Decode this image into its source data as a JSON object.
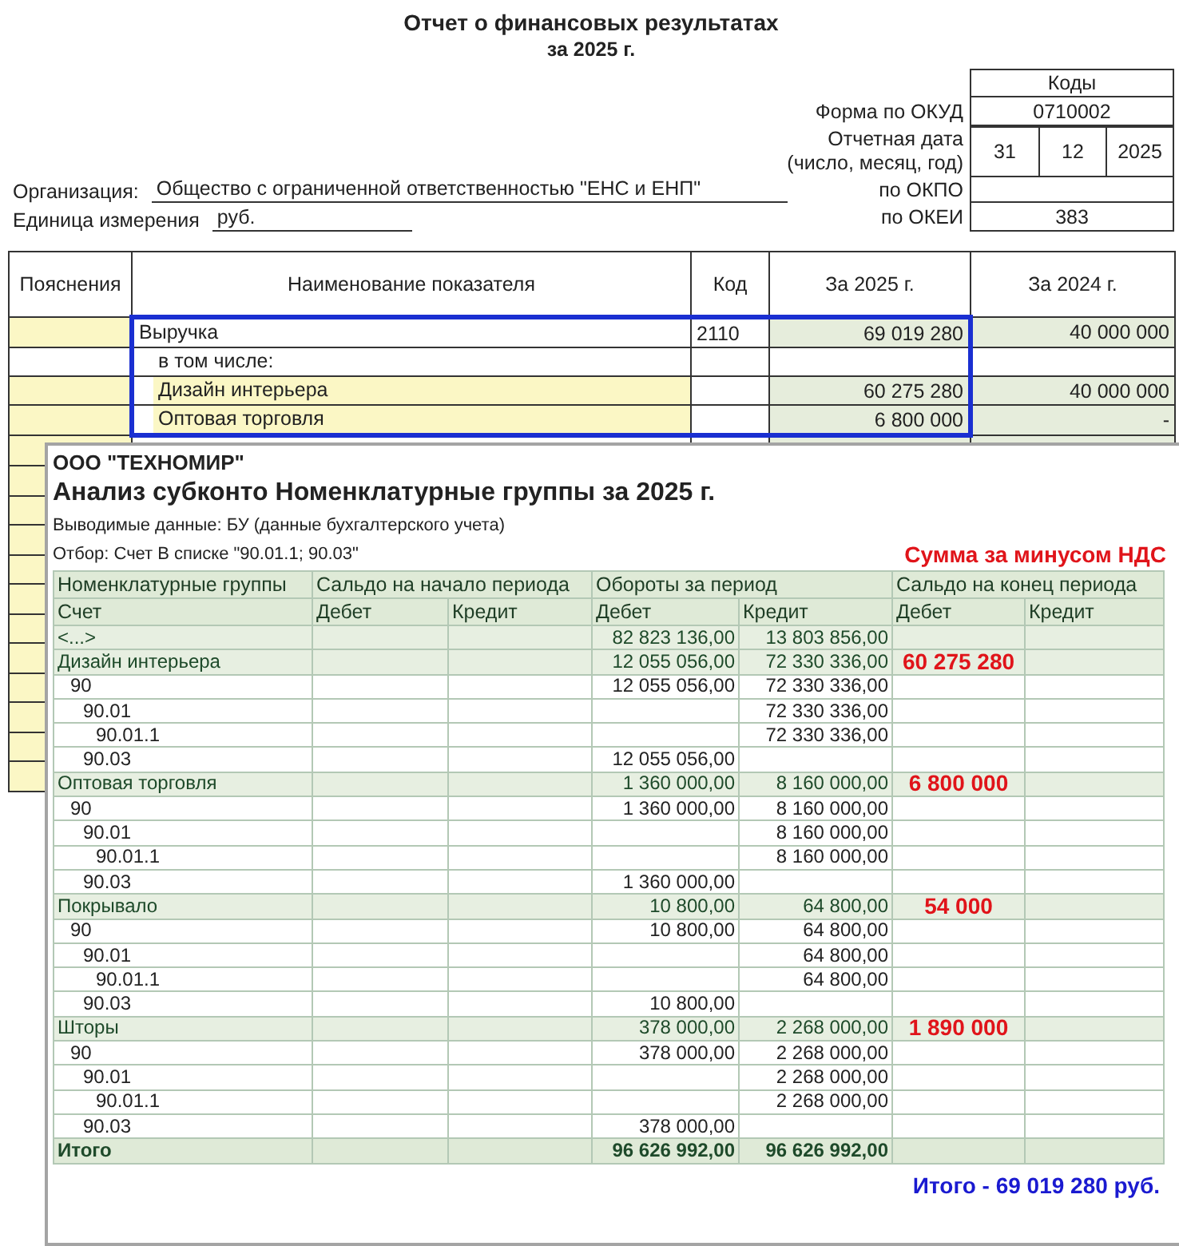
{
  "header": {
    "title": "Отчет о финансовых результатах",
    "period": "за 2025 г.",
    "codes_heading": "Коды",
    "okud_label": "Форма по ОКУД",
    "okud": "0710002",
    "date_label": "Отчетная дата",
    "date_hint": "(число, месяц, год)",
    "date_day": "31",
    "date_month": "12",
    "date_year": "2025",
    "okpo_label": "по ОКПО",
    "okei_label": "по ОКЕИ",
    "okei": "383",
    "organization_label": "Организация:",
    "organization": "Общество с ограниченной ответственностью \"ЕНС и ЕНП\"",
    "unit_label": "Единица измерения",
    "unit": "руб."
  },
  "statement": {
    "columns": [
      "Пояснения",
      "Наименование показателя",
      "Код",
      "За 2025 г.",
      "За 2024 г."
    ],
    "rows": [
      {
        "kind": "line",
        "name": "Выручка",
        "code": "2110",
        "current": "69 019 280",
        "previous": "40 000 000",
        "highlighted": true
      },
      {
        "kind": "caption",
        "name": "в том числе:",
        "highlighted": true
      },
      {
        "kind": "item",
        "name": "Дизайн интерьера",
        "current": "60 275 280",
        "previous": "40 000 000",
        "highlighted": true
      },
      {
        "kind": "item",
        "name": "Оптовая торговля",
        "current": "6 800 000",
        "previous": "-",
        "highlighted": true
      }
    ]
  },
  "report": {
    "company": "ООО \"ТЕХНОМИР\"",
    "title": "Анализ субконто Номенклатурные группы за 2025 г.",
    "output_data": "Выводимые данные: БУ (данные бухгалтерского учета)",
    "filter": "Отбор: Счет В списке \"90.01.1; 90.03\"",
    "note": "Сумма за минусом НДС",
    "header_groups": [
      "Номенклатурные группы",
      "Сальдо на начало периода",
      "Обороты за период",
      "Сальдо на конец периода"
    ],
    "subheaders": [
      "Счет",
      "Дебет",
      "Кредит",
      "Дебет",
      "Кредит",
      "Дебет",
      "Кредит"
    ],
    "rows": [
      {
        "name": "<...>",
        "debit": "82 823 136,00",
        "credit": "13 803 856,00"
      },
      {
        "name": "Дизайн интерьера",
        "debit": "12 055 056,00",
        "credit": "72 330 336,00",
        "net": "60 275 280",
        "accounts": [
          {
            "account": "90",
            "debit": "12 055 056,00",
            "credit": "72 330 336,00",
            "children": [
              {
                "account": "90.01",
                "credit": "72 330 336,00",
                "children": [
                  {
                    "account": "90.01.1",
                    "credit": "72 330 336,00"
                  }
                ]
              },
              {
                "account": "90.03",
                "debit": "12 055 056,00"
              }
            ]
          }
        ]
      },
      {
        "name": "Оптовая торговля",
        "debit": "1 360 000,00",
        "credit": "8 160 000,00",
        "net": "6 800 000",
        "accounts": [
          {
            "account": "90",
            "debit": "1 360 000,00",
            "credit": "8 160 000,00",
            "children": [
              {
                "account": "90.01",
                "credit": "8 160 000,00",
                "children": [
                  {
                    "account": "90.01.1",
                    "credit": "8 160 000,00"
                  }
                ]
              },
              {
                "account": "90.03",
                "debit": "1 360 000,00"
              }
            ]
          }
        ]
      },
      {
        "name": "Покрывало",
        "debit": "10 800,00",
        "credit": "64 800,00",
        "net": "54 000",
        "accounts": [
          {
            "account": "90",
            "debit": "10 800,00",
            "credit": "64 800,00",
            "children": [
              {
                "account": "90.01",
                "credit": "64 800,00",
                "children": [
                  {
                    "account": "90.01.1",
                    "credit": "64 800,00"
                  }
                ]
              },
              {
                "account": "90.03",
                "debit": "10 800,00"
              }
            ]
          }
        ]
      },
      {
        "name": "Шторы",
        "debit": "378 000,00",
        "credit": "2 268 000,00",
        "net": "1 890 000",
        "accounts": [
          {
            "account": "90",
            "debit": "378 000,00",
            "credit": "2 268 000,00",
            "children": [
              {
                "account": "90.01",
                "credit": "2 268 000,00",
                "children": [
                  {
                    "account": "90.01.1",
                    "credit": "2 268 000,00"
                  }
                ]
              },
              {
                "account": "90.03",
                "debit": "378 000,00"
              }
            ]
          }
        ]
      }
    ],
    "total": {
      "label": "Итого",
      "debit": "96 626 992,00",
      "credit": "96 626 992,00"
    },
    "summary": "Итого - 69 019 280 руб."
  }
}
